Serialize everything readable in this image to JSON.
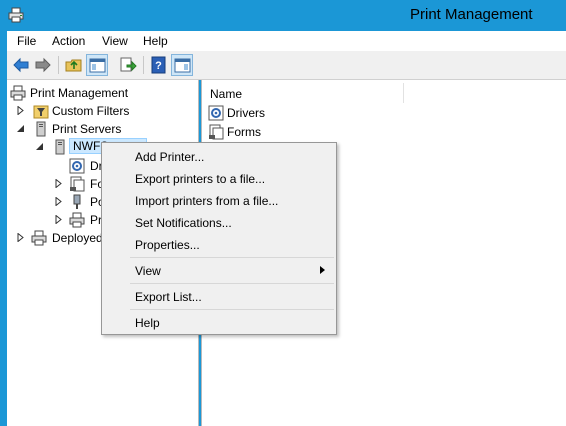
{
  "window": {
    "title": "Print Management"
  },
  "menubar": {
    "items": [
      "File",
      "Action",
      "View",
      "Help"
    ]
  },
  "tree": {
    "root": "Print Management",
    "custom_filters": "Custom Filters",
    "print_servers": "Print Servers",
    "server": "NWFS",
    "drivers_partial": "Dr",
    "forms_partial": "Fo",
    "ports_partial": "Po",
    "printers_partial": "Pr",
    "deployed": "Deployed"
  },
  "list": {
    "column_name": "Name",
    "items": [
      "Drivers",
      "Forms"
    ]
  },
  "context_menu": {
    "add_printer": "Add Printer...",
    "export_printers": "Export printers to a file...",
    "import_printers": "Import printers from a file...",
    "set_notifications": "Set Notifications...",
    "properties": "Properties...",
    "view": "View",
    "export_list": "Export List...",
    "help": "Help"
  },
  "colors": {
    "titlebar": "#1b97d6",
    "selection": "#cce8ff",
    "menu_bg": "#f0f0f0"
  }
}
